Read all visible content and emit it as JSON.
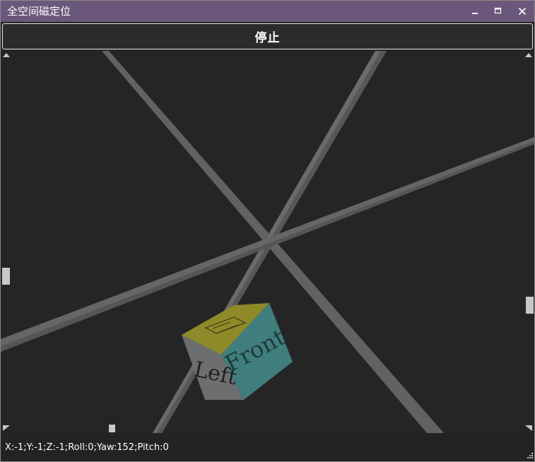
{
  "window": {
    "title": "全空间磁定位",
    "controls": [
      "minimize-icon",
      "maximize-icon",
      "close-icon"
    ]
  },
  "toolbar": {
    "stop_label": "停止"
  },
  "scene": {
    "cube_faces": {
      "left_label": "Left",
      "front_label": "Front"
    },
    "colors": {
      "background": "#252525",
      "axis": "#6a6a6a",
      "face_left": "#6e6e6e",
      "face_front": "#3f7e7d",
      "face_top": "#8e8a2a"
    }
  },
  "status": {
    "readout": "X:-1;Y:-1;Z:-1;Roll:0;Yaw:152;Pitch:0"
  }
}
